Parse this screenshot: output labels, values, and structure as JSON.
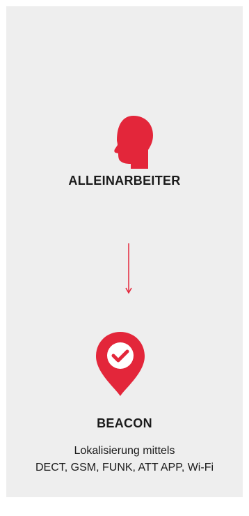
{
  "colors": {
    "background": "#eeeeee",
    "accent": "#e3263a",
    "text": "#1a1a1a"
  },
  "nodes": [
    {
      "icon": "person-head-icon",
      "title": "ALLEINARBEITER"
    },
    {
      "icon": "location-pin-check-icon",
      "title": "BEACON",
      "description_lines": [
        "Lokalisierung mittels",
        "DECT, GSM, FUNK, ATT APP, Wi-Fi"
      ]
    }
  ],
  "connector": {
    "icon": "arrow-down-icon"
  }
}
